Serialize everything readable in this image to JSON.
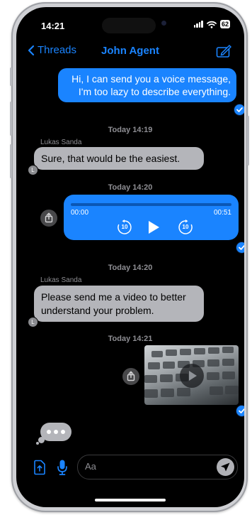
{
  "status": {
    "time": "14:21",
    "battery": "62"
  },
  "nav": {
    "back_label": "Threads",
    "title": "John Agent"
  },
  "messages": {
    "m1": {
      "text": "Hi, I can send you a voice message, I'm too lazy to describe everything."
    },
    "ts1": "Today 14:19",
    "m2": {
      "sender": "Lukas Sanda",
      "text": "Sure, that would be the easiest.",
      "avatar": "L"
    },
    "ts2": "Today 14:20",
    "voice": {
      "elapsed": "00:00",
      "duration": "00:51",
      "skip_back": "10",
      "skip_forward": "10",
      "progress": 0
    },
    "ts3": "Today 14:20",
    "m3": {
      "sender": "Lukas Sanda",
      "text": "Please send me a video to better understand your problem.",
      "avatar": "L"
    },
    "ts4": "Today 14:21"
  },
  "composer": {
    "placeholder": "Aa"
  },
  "colors": {
    "accent": "#1a84ff",
    "incoming_bubble": "#b4b5ba",
    "background": "#000000"
  }
}
